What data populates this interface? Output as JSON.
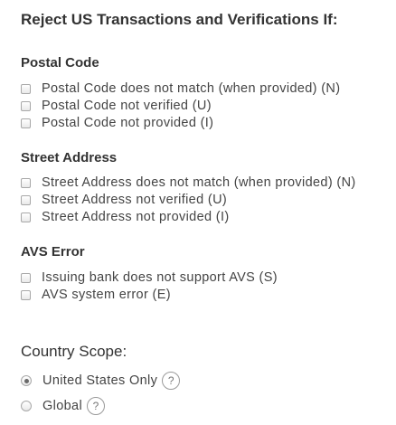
{
  "title": "Reject US Transactions and Verifications If:",
  "sections": [
    {
      "title": "Postal Code",
      "options": [
        {
          "label": "Postal Code does not match (when provided) (N)",
          "checked": false
        },
        {
          "label": "Postal Code not verified (U)",
          "checked": false
        },
        {
          "label": "Postal Code not provided (I)",
          "checked": false
        }
      ]
    },
    {
      "title": "Street Address",
      "options": [
        {
          "label": "Street Address does not match (when provided) (N)",
          "checked": false
        },
        {
          "label": "Street Address not verified (U)",
          "checked": false
        },
        {
          "label": "Street Address not provided (I)",
          "checked": false
        }
      ]
    },
    {
      "title": "AVS Error",
      "options": [
        {
          "label": "Issuing bank does not support AVS (S)",
          "checked": false
        },
        {
          "label": "AVS system error (E)",
          "checked": false
        }
      ]
    }
  ],
  "country_scope": {
    "title": "Country Scope:",
    "options": [
      {
        "label": "United States Only",
        "selected": true,
        "help": "?"
      },
      {
        "label": "Global",
        "selected": false,
        "help": "?"
      }
    ]
  }
}
